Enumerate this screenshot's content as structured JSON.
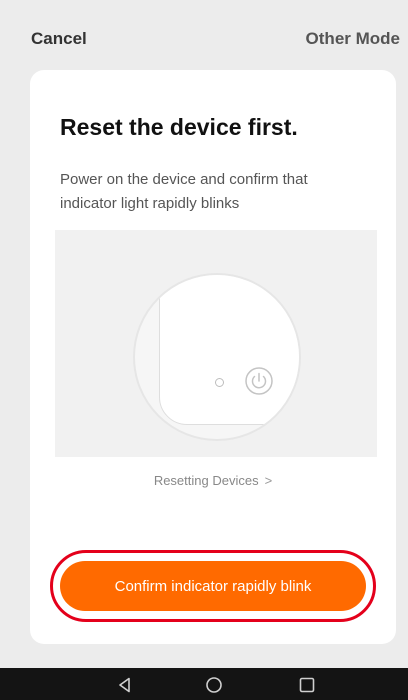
{
  "header": {
    "cancel_label": "Cancel",
    "other_mode_label": "Other Mode"
  },
  "card": {
    "title": "Reset the device first.",
    "description": "Power on the device and confirm that indicator light rapidly blinks",
    "resetting_link": "Resetting Devices",
    "resetting_chevron": ">",
    "confirm_button": "Confirm indicator rapidly blink"
  },
  "icons": {
    "power": "power-icon",
    "indicator": "indicator-led-icon",
    "back": "triangle-back-icon",
    "home": "circle-home-icon",
    "recent": "square-recent-icon"
  },
  "colors": {
    "accent": "#ff6a00",
    "highlight_ring": "#e4001b",
    "background": "#ececec",
    "navbar": "#141414"
  }
}
